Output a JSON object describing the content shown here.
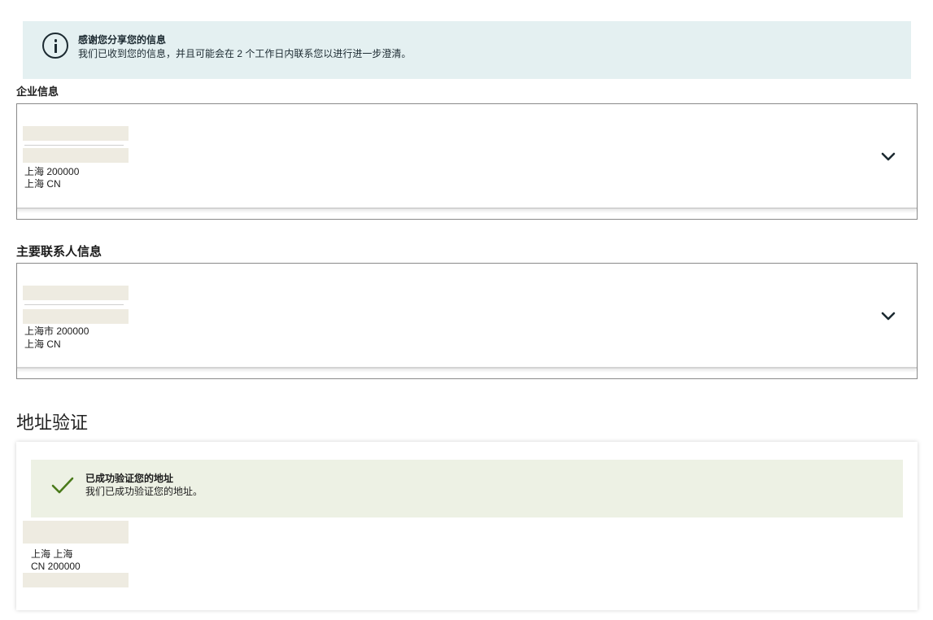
{
  "info_banner": {
    "title": "感谢您分享您的信息",
    "message": "我们已收到您的信息，并且可能会在 2 个工作日内联系您以进行进一步澄清。"
  },
  "business_info": {
    "title": "企业信息",
    "address_line1": "上海 200000",
    "address_line2": "上海 CN"
  },
  "primary_contact": {
    "title": "主要联系人信息",
    "address_line1": "上海市 200000",
    "address_line2": "上海 CN"
  },
  "address_verification": {
    "title": "地址验证",
    "success_title": "已成功验证您的地址",
    "success_message": "我们已成功验证您的地址。",
    "address_line1": "上海 上海",
    "address_line2": "CN 200000"
  },
  "icons": {
    "info": "info-icon",
    "chevron": "chevron-down-icon",
    "check": "check-icon"
  },
  "colors": {
    "info_banner_bg": "#e4f0f1",
    "success_banner_bg": "#edf1e4",
    "check_green": "#4a7a1a",
    "redaction": "#eeebe1"
  }
}
